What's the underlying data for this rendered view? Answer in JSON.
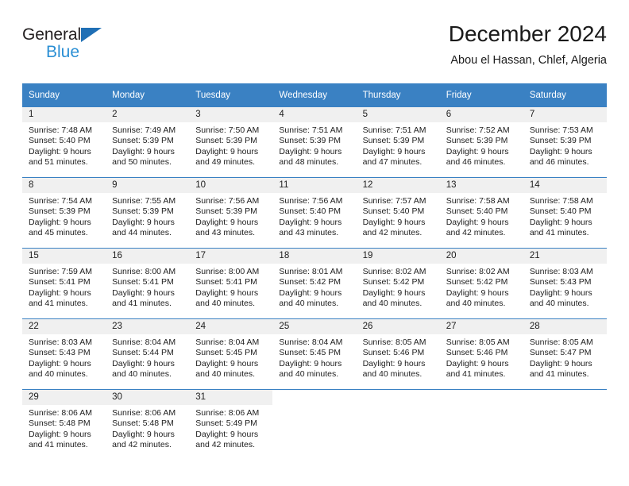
{
  "brand": {
    "name_top": "General",
    "name_bottom": "Blue",
    "color_dark": "#231f20",
    "color_blue": "#2b8fd4"
  },
  "header": {
    "title": "December 2024",
    "subtitle": "Abou el Hassan, Chlef, Algeria"
  },
  "theme": {
    "header_bg": "#3a81c3",
    "header_text": "#ffffff",
    "daynum_bg": "#f0f0f0",
    "grid_line": "#3a81c3"
  },
  "weekdays": [
    "Sunday",
    "Monday",
    "Tuesday",
    "Wednesday",
    "Thursday",
    "Friday",
    "Saturday"
  ],
  "weeks": [
    [
      {
        "day": "1",
        "sunrise": "Sunrise: 7:48 AM",
        "sunset": "Sunset: 5:40 PM",
        "daylight": "Daylight: 9 hours and 51 minutes."
      },
      {
        "day": "2",
        "sunrise": "Sunrise: 7:49 AM",
        "sunset": "Sunset: 5:39 PM",
        "daylight": "Daylight: 9 hours and 50 minutes."
      },
      {
        "day": "3",
        "sunrise": "Sunrise: 7:50 AM",
        "sunset": "Sunset: 5:39 PM",
        "daylight": "Daylight: 9 hours and 49 minutes."
      },
      {
        "day": "4",
        "sunrise": "Sunrise: 7:51 AM",
        "sunset": "Sunset: 5:39 PM",
        "daylight": "Daylight: 9 hours and 48 minutes."
      },
      {
        "day": "5",
        "sunrise": "Sunrise: 7:51 AM",
        "sunset": "Sunset: 5:39 PM",
        "daylight": "Daylight: 9 hours and 47 minutes."
      },
      {
        "day": "6",
        "sunrise": "Sunrise: 7:52 AM",
        "sunset": "Sunset: 5:39 PM",
        "daylight": "Daylight: 9 hours and 46 minutes."
      },
      {
        "day": "7",
        "sunrise": "Sunrise: 7:53 AM",
        "sunset": "Sunset: 5:39 PM",
        "daylight": "Daylight: 9 hours and 46 minutes."
      }
    ],
    [
      {
        "day": "8",
        "sunrise": "Sunrise: 7:54 AM",
        "sunset": "Sunset: 5:39 PM",
        "daylight": "Daylight: 9 hours and 45 minutes."
      },
      {
        "day": "9",
        "sunrise": "Sunrise: 7:55 AM",
        "sunset": "Sunset: 5:39 PM",
        "daylight": "Daylight: 9 hours and 44 minutes."
      },
      {
        "day": "10",
        "sunrise": "Sunrise: 7:56 AM",
        "sunset": "Sunset: 5:39 PM",
        "daylight": "Daylight: 9 hours and 43 minutes."
      },
      {
        "day": "11",
        "sunrise": "Sunrise: 7:56 AM",
        "sunset": "Sunset: 5:40 PM",
        "daylight": "Daylight: 9 hours and 43 minutes."
      },
      {
        "day": "12",
        "sunrise": "Sunrise: 7:57 AM",
        "sunset": "Sunset: 5:40 PM",
        "daylight": "Daylight: 9 hours and 42 minutes."
      },
      {
        "day": "13",
        "sunrise": "Sunrise: 7:58 AM",
        "sunset": "Sunset: 5:40 PM",
        "daylight": "Daylight: 9 hours and 42 minutes."
      },
      {
        "day": "14",
        "sunrise": "Sunrise: 7:58 AM",
        "sunset": "Sunset: 5:40 PM",
        "daylight": "Daylight: 9 hours and 41 minutes."
      }
    ],
    [
      {
        "day": "15",
        "sunrise": "Sunrise: 7:59 AM",
        "sunset": "Sunset: 5:41 PM",
        "daylight": "Daylight: 9 hours and 41 minutes."
      },
      {
        "day": "16",
        "sunrise": "Sunrise: 8:00 AM",
        "sunset": "Sunset: 5:41 PM",
        "daylight": "Daylight: 9 hours and 41 minutes."
      },
      {
        "day": "17",
        "sunrise": "Sunrise: 8:00 AM",
        "sunset": "Sunset: 5:41 PM",
        "daylight": "Daylight: 9 hours and 40 minutes."
      },
      {
        "day": "18",
        "sunrise": "Sunrise: 8:01 AM",
        "sunset": "Sunset: 5:42 PM",
        "daylight": "Daylight: 9 hours and 40 minutes."
      },
      {
        "day": "19",
        "sunrise": "Sunrise: 8:02 AM",
        "sunset": "Sunset: 5:42 PM",
        "daylight": "Daylight: 9 hours and 40 minutes."
      },
      {
        "day": "20",
        "sunrise": "Sunrise: 8:02 AM",
        "sunset": "Sunset: 5:42 PM",
        "daylight": "Daylight: 9 hours and 40 minutes."
      },
      {
        "day": "21",
        "sunrise": "Sunrise: 8:03 AM",
        "sunset": "Sunset: 5:43 PM",
        "daylight": "Daylight: 9 hours and 40 minutes."
      }
    ],
    [
      {
        "day": "22",
        "sunrise": "Sunrise: 8:03 AM",
        "sunset": "Sunset: 5:43 PM",
        "daylight": "Daylight: 9 hours and 40 minutes."
      },
      {
        "day": "23",
        "sunrise": "Sunrise: 8:04 AM",
        "sunset": "Sunset: 5:44 PM",
        "daylight": "Daylight: 9 hours and 40 minutes."
      },
      {
        "day": "24",
        "sunrise": "Sunrise: 8:04 AM",
        "sunset": "Sunset: 5:45 PM",
        "daylight": "Daylight: 9 hours and 40 minutes."
      },
      {
        "day": "25",
        "sunrise": "Sunrise: 8:04 AM",
        "sunset": "Sunset: 5:45 PM",
        "daylight": "Daylight: 9 hours and 40 minutes."
      },
      {
        "day": "26",
        "sunrise": "Sunrise: 8:05 AM",
        "sunset": "Sunset: 5:46 PM",
        "daylight": "Daylight: 9 hours and 40 minutes."
      },
      {
        "day": "27",
        "sunrise": "Sunrise: 8:05 AM",
        "sunset": "Sunset: 5:46 PM",
        "daylight": "Daylight: 9 hours and 41 minutes."
      },
      {
        "day": "28",
        "sunrise": "Sunrise: 8:05 AM",
        "sunset": "Sunset: 5:47 PM",
        "daylight": "Daylight: 9 hours and 41 minutes."
      }
    ],
    [
      {
        "day": "29",
        "sunrise": "Sunrise: 8:06 AM",
        "sunset": "Sunset: 5:48 PM",
        "daylight": "Daylight: 9 hours and 41 minutes."
      },
      {
        "day": "30",
        "sunrise": "Sunrise: 8:06 AM",
        "sunset": "Sunset: 5:48 PM",
        "daylight": "Daylight: 9 hours and 42 minutes."
      },
      {
        "day": "31",
        "sunrise": "Sunrise: 8:06 AM",
        "sunset": "Sunset: 5:49 PM",
        "daylight": "Daylight: 9 hours and 42 minutes."
      },
      {
        "day": "",
        "sunrise": "",
        "sunset": "",
        "daylight": ""
      },
      {
        "day": "",
        "sunrise": "",
        "sunset": "",
        "daylight": ""
      },
      {
        "day": "",
        "sunrise": "",
        "sunset": "",
        "daylight": ""
      },
      {
        "day": "",
        "sunrise": "",
        "sunset": "",
        "daylight": ""
      }
    ]
  ]
}
